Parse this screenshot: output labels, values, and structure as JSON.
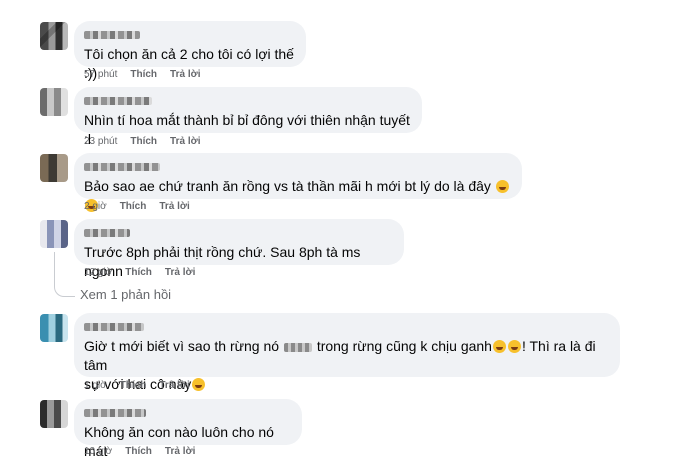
{
  "comments": [
    {
      "text": "Tôi chọn ăn cả 2 cho tôi có lợi thế :))",
      "time": "57 phút",
      "like": "Thích",
      "reply": "Trả lời"
    },
    {
      "text": "Nhìn tí hoa mắt thành bỉ bỉ đông với thiên nhận tuyết :l",
      "time": "23 phút",
      "like": "Thích",
      "reply": "Trả lời"
    },
    {
      "text": "Bảo sao ae chứ tranh ăn rồng vs tà thần mãi h mới bt lý do là đây",
      "time": "2 giờ",
      "like": "Thích",
      "reply": "Trả lời"
    },
    {
      "text": "Trước 8ph phải thịt rồng chứ. Sau 8ph tà ms ngonn",
      "time": "12 giờ",
      "like": "Thích",
      "reply": "Trả lời",
      "view_replies": "Xem 1 phản hồi"
    },
    {
      "text_a": "Giờ t mới biết vì sao th rừng nó",
      "text_b": "trong rừng cũng k chịu ganh",
      "text_c": "! Thì ra là đi tâm",
      "text_d": "sự với hai cô này",
      "time": "1 giờ",
      "like": "Thích",
      "reply": "Trả lời"
    },
    {
      "text": "Không ăn con nào luôn cho nó mát",
      "time": "10 giờ",
      "like": "Thích",
      "reply": "Trả lời"
    }
  ]
}
